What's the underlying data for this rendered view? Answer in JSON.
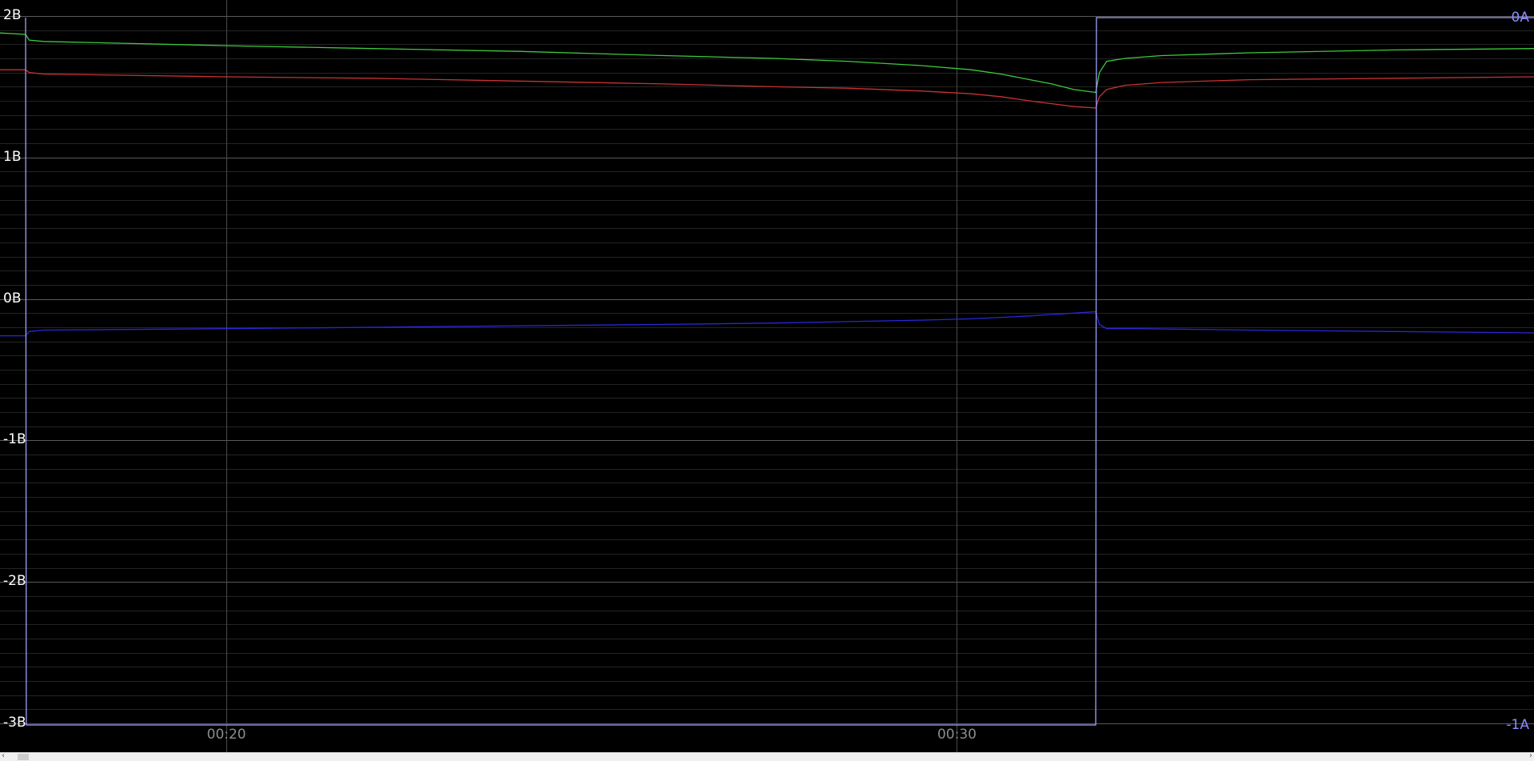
{
  "chart_data": {
    "type": "line",
    "x_ticks": [
      {
        "t": 20,
        "label": "00:20"
      },
      {
        "t": 30,
        "label": "00:30"
      }
    ],
    "xlim": [
      16.9,
      37.9
    ],
    "left_axis": {
      "ylim": [
        -3,
        2
      ],
      "ticks": [
        {
          "v": 2,
          "label": "2В"
        },
        {
          "v": 1,
          "label": "1В"
        },
        {
          "v": 0,
          "label": "0В"
        },
        {
          "v": -1,
          "label": "-1В"
        },
        {
          "v": -2,
          "label": "-2В"
        },
        {
          "v": -3,
          "label": "-3В"
        }
      ],
      "minor_step": 0.1
    },
    "right_axis": {
      "ylim": [
        -1,
        0
      ],
      "ticks": [
        {
          "v": 0,
          "label": "0А"
        },
        {
          "v": -1,
          "label": "-1А"
        }
      ]
    },
    "series": [
      {
        "axis": "left",
        "color": "#3ec83e",
        "points": [
          [
            16.9,
            1.88
          ],
          [
            17.25,
            1.87
          ],
          [
            17.3,
            1.83
          ],
          [
            17.5,
            1.82
          ],
          [
            20,
            1.79
          ],
          [
            22,
            1.77
          ],
          [
            24,
            1.75
          ],
          [
            26,
            1.72
          ],
          [
            27.5,
            1.7
          ],
          [
            28.5,
            1.68
          ],
          [
            29.5,
            1.65
          ],
          [
            30.2,
            1.62
          ],
          [
            30.6,
            1.59
          ],
          [
            31,
            1.55
          ],
          [
            31.3,
            1.52
          ],
          [
            31.6,
            1.48
          ],
          [
            31.9,
            1.46
          ],
          [
            31.95,
            1.6
          ],
          [
            32.05,
            1.68
          ],
          [
            32.3,
            1.7
          ],
          [
            32.8,
            1.72
          ],
          [
            34,
            1.74
          ],
          [
            36,
            1.76
          ],
          [
            37.9,
            1.77
          ]
        ]
      },
      {
        "axis": "left",
        "color": "#c83232",
        "points": [
          [
            16.9,
            1.62
          ],
          [
            17.25,
            1.62
          ],
          [
            17.3,
            1.6
          ],
          [
            17.5,
            1.59
          ],
          [
            20,
            1.57
          ],
          [
            22,
            1.56
          ],
          [
            24,
            1.54
          ],
          [
            26,
            1.52
          ],
          [
            27.5,
            1.5
          ],
          [
            28.5,
            1.49
          ],
          [
            29.5,
            1.47
          ],
          [
            30.2,
            1.45
          ],
          [
            30.6,
            1.43
          ],
          [
            31,
            1.4
          ],
          [
            31.3,
            1.38
          ],
          [
            31.6,
            1.36
          ],
          [
            31.9,
            1.35
          ],
          [
            31.95,
            1.43
          ],
          [
            32.05,
            1.48
          ],
          [
            32.3,
            1.51
          ],
          [
            32.8,
            1.53
          ],
          [
            34,
            1.55
          ],
          [
            36,
            1.56
          ],
          [
            37.9,
            1.57
          ]
        ]
      },
      {
        "axis": "left",
        "color": "#2828d8",
        "points": [
          [
            16.9,
            -0.26
          ],
          [
            17.25,
            -0.26
          ],
          [
            17.3,
            -0.23
          ],
          [
            17.5,
            -0.22
          ],
          [
            20,
            -0.21
          ],
          [
            22,
            -0.2
          ],
          [
            24,
            -0.19
          ],
          [
            26,
            -0.18
          ],
          [
            27.5,
            -0.17
          ],
          [
            28.5,
            -0.16
          ],
          [
            29.5,
            -0.15
          ],
          [
            30.2,
            -0.14
          ],
          [
            30.6,
            -0.13
          ],
          [
            31,
            -0.12
          ],
          [
            31.3,
            -0.11
          ],
          [
            31.6,
            -0.1
          ],
          [
            31.9,
            -0.09
          ],
          [
            31.95,
            -0.18
          ],
          [
            32.05,
            -0.21
          ],
          [
            32.5,
            -0.21
          ],
          [
            34,
            -0.22
          ],
          [
            36,
            -0.23
          ],
          [
            37.9,
            -0.24
          ]
        ]
      },
      {
        "axis": "right",
        "color": "#a0a0ff",
        "points": [
          [
            17.25,
            0
          ],
          [
            17.26,
            -1
          ],
          [
            31.9,
            -1
          ],
          [
            31.91,
            0
          ],
          [
            37.9,
            0
          ]
        ]
      }
    ]
  }
}
